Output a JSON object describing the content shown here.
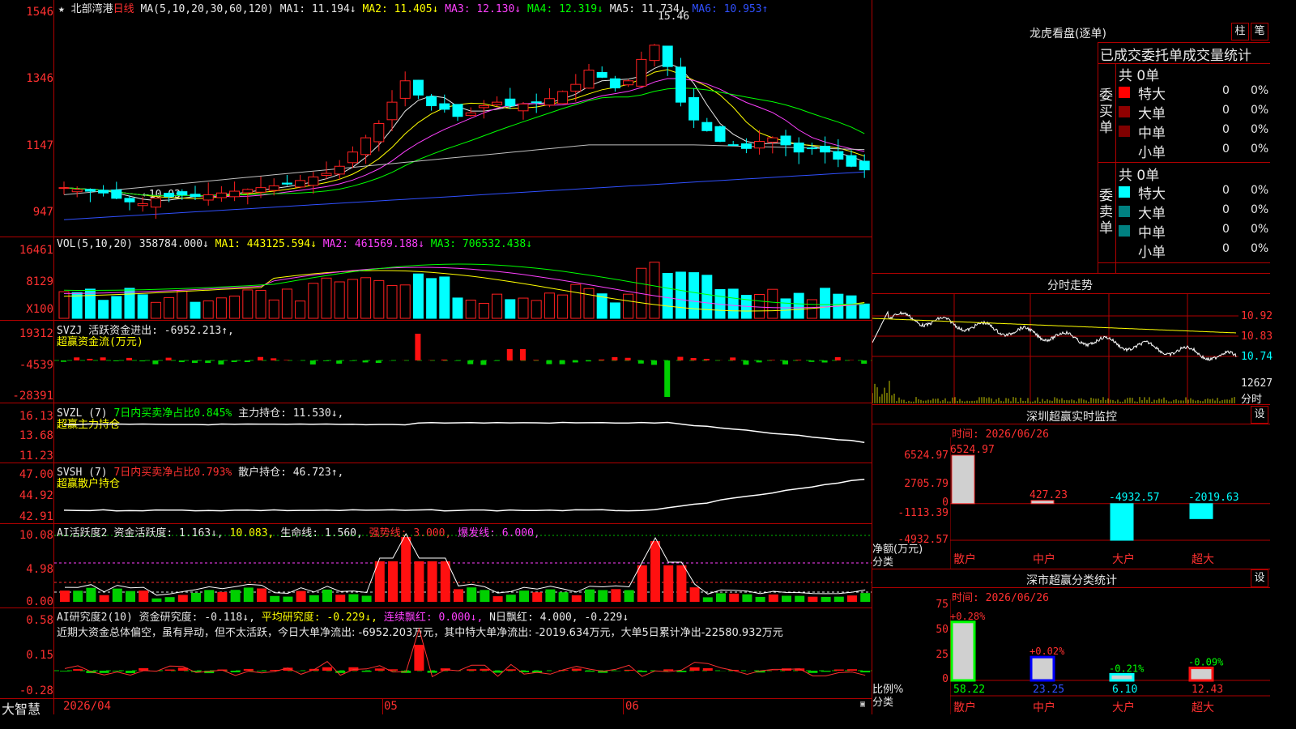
{
  "app": {
    "name": "大智慧",
    "stock_name": "北部湾港",
    "period": "日线"
  },
  "main_chart": {
    "ma_label": "MA(5,10,20,30,60,120)",
    "ma_values": [
      {
        "label": "MA1: 11.194↓",
        "color": "#e8e8e8"
      },
      {
        "label": "MA2: 11.405↓",
        "color": "#ffff00"
      },
      {
        "label": "MA3: 12.130↓",
        "color": "#ff40ff"
      },
      {
        "label": "MA4: 12.319↓",
        "color": "#00ff00"
      },
      {
        "label": "MA5: 11.734↓",
        "color": "#e8e8e8"
      },
      {
        "label": "MA6: 10.953↑",
        "color": "#3050ff"
      }
    ],
    "y_ticks": [
      "1546",
      "1346",
      "1147",
      "947"
    ],
    "high_label": "15.46",
    "low_label": "←10.03"
  },
  "volume": {
    "label": "VOL(5,10,20)",
    "value": "358784.000↓",
    "ma1": "MA1: 443125.594↓",
    "ma2": "MA2: 461569.188↓",
    "ma3": "MA3: 706532.438↓",
    "y_ticks": [
      "16461",
      "8129"
    ],
    "unit": "X100"
  },
  "svzj": {
    "label": "SVZJ",
    "text": "活跃资金进出: -6952.213↑,",
    "subtitle": "超赢资金流(万元)",
    "y_ticks": [
      "19312",
      "-4539",
      "-28391"
    ]
  },
  "svzl": {
    "label": "SVZL (7)",
    "text1": "7日内买卖净占比0.845%",
    "text2": "主力持仓: 11.530↓,",
    "subtitle": "超赢主力持仓",
    "y_ticks": [
      "16.13",
      "13.68",
      "11.23"
    ]
  },
  "svsh": {
    "label": "SVSH (7)",
    "text1": "7日内买卖净占比0.793%",
    "text2": "散户持仓: 46.723↑,",
    "subtitle": "超赢散户持仓",
    "y_ticks": [
      "47.00",
      "44.92",
      "42.91"
    ]
  },
  "ai_active": {
    "label": "AI活跃度2",
    "t1": "资金活跃度: 1.163↓,",
    "t2": "10.083,",
    "t3": "生命线: 1.560,",
    "t4": "强势线: 3.000,",
    "t5": "爆发线: 6.000,",
    "y_ticks": [
      "10.08",
      "4.98",
      "0.00"
    ]
  },
  "ai_research": {
    "label": "AI研究度2(10)",
    "t1": "资金研究度: -0.118↓,",
    "t2": "平均研究度: -0.229↓,",
    "t3": "连续飘红: 0.000↓,",
    "t4": "N日飘红: 4.000,",
    "t5": "-0.229↓",
    "summary": "近期大资金总体偏空，虽有异动，但不太活跃，今日大单净流出: -6952.203万元，其中特大单净流出: -2019.634万元，大单5日累计净出-22580.932万元",
    "y_ticks": [
      "0.58",
      "0.15",
      "-0.28"
    ]
  },
  "x_axis": {
    "labels": [
      "2026/04",
      "05",
      "06"
    ]
  },
  "right_panel": {
    "dragon": {
      "title": "龙虎看盘(逐单)",
      "btn_column": "柱",
      "btn_trade": "笔",
      "subtitle": "已成交委托单成交量统计",
      "buy_side": "委买单",
      "sell_side": "委卖单",
      "buy_total": "共 0单",
      "sell_total": "共 0单",
      "buy_rows": [
        {
          "label": "特大",
          "color": "#ff0000",
          "value": "0",
          "pct": "0%"
        },
        {
          "label": "大单",
          "color": "#900000",
          "value": "0",
          "pct": "0%"
        },
        {
          "label": "中单",
          "color": "#800000",
          "value": "0",
          "pct": "0%"
        },
        {
          "label": "小单",
          "color": "",
          "value": "0",
          "pct": "0%"
        }
      ],
      "sell_rows": [
        {
          "label": "特大",
          "color": "#00ffff",
          "value": "0",
          "pct": "0%"
        },
        {
          "label": "大单",
          "color": "#008080",
          "value": "0",
          "pct": "0%"
        },
        {
          "label": "中单",
          "color": "#008080",
          "value": "0",
          "pct": "0%"
        },
        {
          "label": "小单",
          "color": "",
          "value": "0",
          "pct": "0%"
        }
      ]
    },
    "intraday": {
      "title": "分时走势",
      "y_ticks": [
        "10.92",
        "10.83",
        "10.74"
      ],
      "vol_label": "12627",
      "vol_unit": "分时"
    },
    "monitor": {
      "title": "深圳超赢实时监控",
      "btn": "设",
      "time": "时间: 2026/06/26",
      "y_ticks": [
        "6524.97",
        "2705.79",
        "0",
        "-1113.39",
        "-4932.57"
      ],
      "unit": "净额(万元)",
      "cat_label": "分类",
      "categories": [
        "散户",
        "中户",
        "大户",
        "超大"
      ],
      "values": [
        6524.97,
        427.23,
        -4932.57,
        -2019.63
      ],
      "value_labels": [
        "6524.97",
        "427.23",
        "-4932.57",
        "-2019.63"
      ]
    },
    "classify": {
      "title": "深市超赢分类统计",
      "btn": "设",
      "time": "时间: 2026/06/26",
      "y_ticks": [
        "75",
        "50",
        "25",
        "0"
      ],
      "unit": "比例%",
      "cat_label": "分类",
      "categories": [
        "散户",
        "中户",
        "大户",
        "超大"
      ],
      "ratios": [
        58.22,
        23.25,
        6.1,
        12.43
      ],
      "ratio_labels": [
        "58.22",
        "23.25",
        "6.10",
        "12.43"
      ],
      "changes": [
        "+0.28%",
        "+0.02%",
        "-0.21%",
        "-0.09%"
      ]
    }
  }
}
